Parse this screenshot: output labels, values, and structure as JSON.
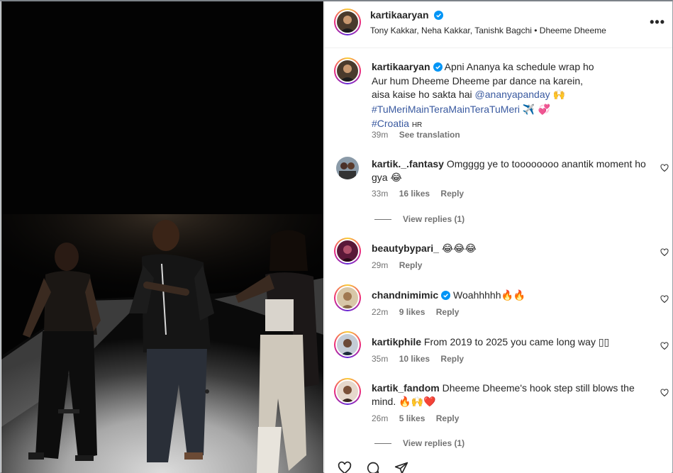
{
  "post": {
    "author": "kartikaaryan",
    "audio": "Tony Kakkar, Neha Kakkar, Tanishk Bagchi • Dheeme Dheeme",
    "more_icon": "•••",
    "caption": {
      "author": "kartikaaryan",
      "line1": "Apni Ananya ka schedule wrap ho",
      "line2": "Aur hum Dheeme Dheeme par dance na karein,",
      "line3": "aisa kaise ho sakta hai",
      "mention": "@ananyapanday",
      "emoji1": "🙌",
      "hashtag1": "#TuMeriMainTeraMainTeraTuMeri",
      "emoji2": "✈️ 💞",
      "hashtag2": "#Croatia",
      "suffix": "HR",
      "time": "39m",
      "see_translation": "See translation"
    }
  },
  "comments": [
    {
      "user": "kartik._.fantasy",
      "text": "Omgggg ye to toooooooo anantik moment ho gya 😂",
      "time": "33m",
      "likes": "16 likes",
      "reply": "Reply",
      "view_replies": "View replies (1)"
    },
    {
      "user": "beautybypari_",
      "text": "😂😂😂",
      "time": "29m",
      "likes": "",
      "reply": "Reply"
    },
    {
      "user": "chandnimimic",
      "text": "Woahhhhh🔥🔥",
      "time": "22m",
      "likes": "9 likes",
      "reply": "Reply"
    },
    {
      "user": "kartikphile",
      "text": "From 2019 to 2025 you came long way ▯▯",
      "time": "35m",
      "likes": "10 likes",
      "reply": "Reply"
    },
    {
      "user": "kartik_fandom",
      "text": "Dheeme Dheeme's hook step still blows the mind. 🔥🙌❤️",
      "time": "26m",
      "likes": "5 likes",
      "reply": "Reply",
      "view_replies": "View replies (1)"
    }
  ],
  "colors": {
    "verified": "#0095f6",
    "link": "#3a5aa0",
    "muted": "#737373"
  },
  "icons": [
    "more-icon",
    "verified-icon",
    "heart-icon",
    "comment-icon",
    "share-icon"
  ]
}
